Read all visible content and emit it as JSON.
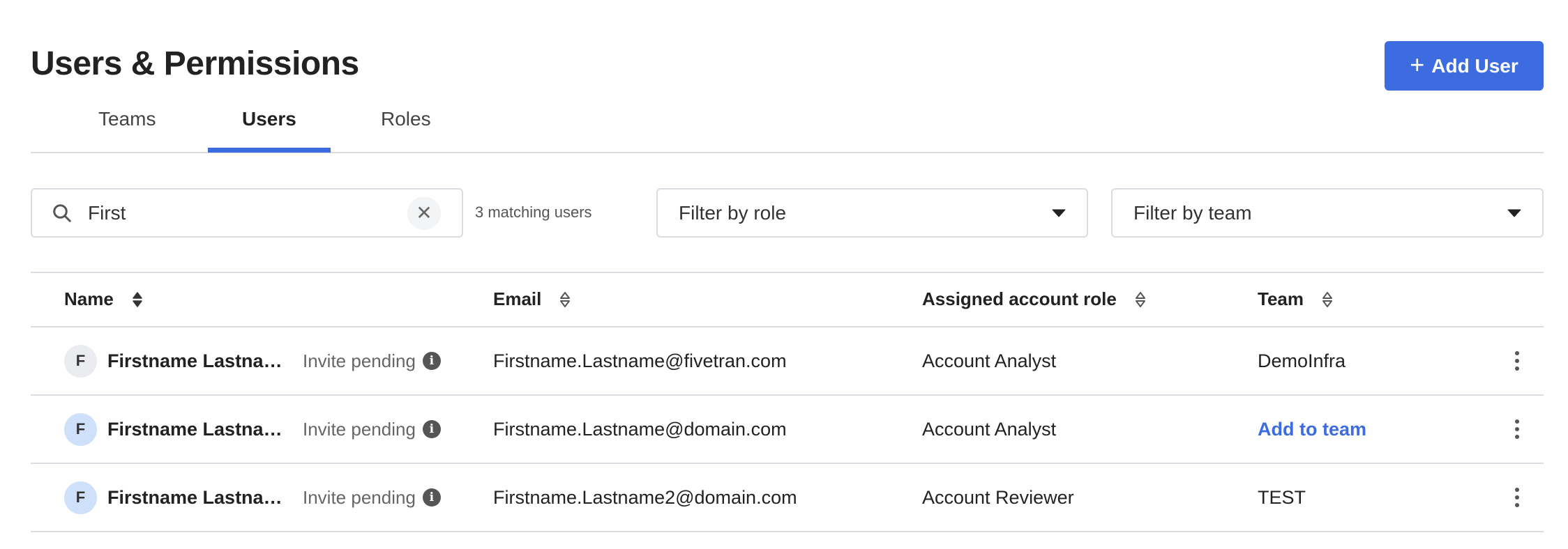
{
  "header": {
    "title": "Users & Permissions",
    "add_user_label": "Add User",
    "add_icon": "plus-icon"
  },
  "tabs": [
    {
      "label": "Teams"
    },
    {
      "label": "Users",
      "active": true
    },
    {
      "label": "Roles"
    }
  ],
  "search": {
    "value": "First",
    "match_count": "3 matching users"
  },
  "filters": {
    "role": "Filter by role",
    "team": "Filter by team"
  },
  "table": {
    "columns": [
      "Name",
      "Email",
      "Assigned account role",
      "Team"
    ],
    "rows": [
      {
        "initial": "F",
        "name": "Firstname Lastname",
        "status": "Invite pending",
        "email": "Firstname.Lastname@fivetran.com",
        "role": "Account Analyst",
        "team": "DemoInfra",
        "avatar_color": "#ebecf0"
      },
      {
        "initial": "F",
        "name": "Firstname Lastname",
        "status": "Invite pending",
        "email": "Firstname.Lastname@domain.com",
        "role": "Account Analyst",
        "team": "Add to team",
        "team_is_link": true,
        "avatar_color": "#cfe0fb"
      },
      {
        "initial": "F",
        "name": "Firstname Lastname",
        "status": "Invite pending",
        "email": "Firstname.Lastname2@domain.com",
        "role": "Account Reviewer",
        "team": "TEST",
        "avatar_color": "#cfe0fb"
      }
    ]
  },
  "colors": {
    "accent": "#3d6ce0"
  }
}
